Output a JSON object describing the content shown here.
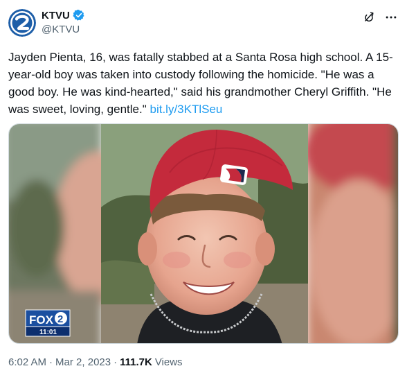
{
  "account": {
    "display_name": "KTVU",
    "handle": "@KTVU",
    "avatar_icon": "ktvu-2-logo-icon",
    "verified_icon": "verified-badge-icon",
    "brand_color": "#1d5ea8"
  },
  "top_actions": {
    "grok_icon": "grok-icon",
    "more_icon": "more-icon"
  },
  "tweet": {
    "text": "Jayden Pienta, 16, was fatally stabbed at a Santa Rosa high school. A 15-year-old boy was taken into custody following the homicide. \"He was a good boy. He was kind-hearted,\" said his grandmother Cheryl Griffith. \"He was sweet, loving, gentle.\" ",
    "link": "bit.ly/3KTlSeu"
  },
  "media": {
    "bug_label": "FOX",
    "bug_number": "2",
    "bug_time": "11:01"
  },
  "meta": {
    "time": "6:02 AM",
    "dot": "·",
    "date": "Mar 2, 2023",
    "views_count": "111.7K",
    "views_label": "Views"
  },
  "colors": {
    "link": "#1d9bf0",
    "secondary_text": "#536471",
    "cap_red": "#c42a3c"
  }
}
